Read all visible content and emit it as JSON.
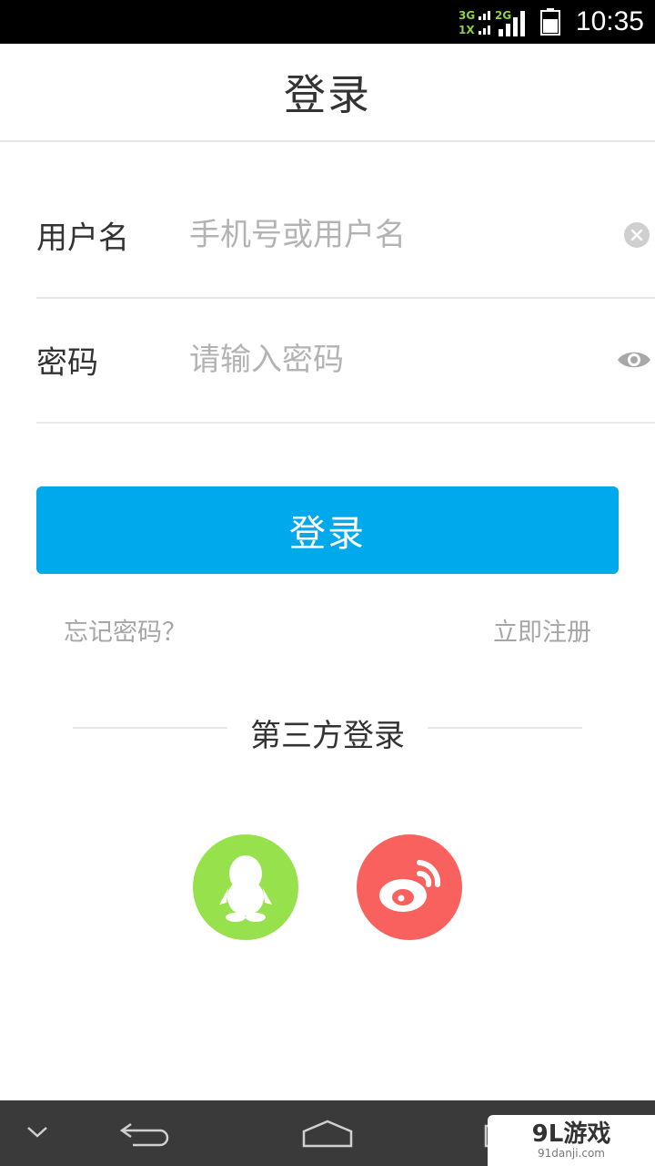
{
  "status_bar": {
    "network_top": "3G",
    "network_bottom": "1X",
    "network_2g": "2G",
    "time": "10:35"
  },
  "header": {
    "title": "登录"
  },
  "form": {
    "username": {
      "label": "用户名",
      "placeholder": "手机号或用户名",
      "value": ""
    },
    "password": {
      "label": "密码",
      "placeholder": "请输入密码",
      "value": ""
    }
  },
  "login_button": {
    "label": "登录"
  },
  "links": {
    "forgot": "忘记密码？",
    "register": "立即注册"
  },
  "third_party": {
    "title": "第三方登录",
    "providers": [
      {
        "icon": "qq-icon",
        "color": "#97e14c"
      },
      {
        "icon": "weibo-icon",
        "color": "#f9615e"
      }
    ]
  },
  "watermark": {
    "main": "9L游戏",
    "sub": "91danji.com"
  },
  "colors": {
    "accent": "#00a8ec",
    "qq": "#97e14c",
    "weibo": "#f9615e"
  }
}
